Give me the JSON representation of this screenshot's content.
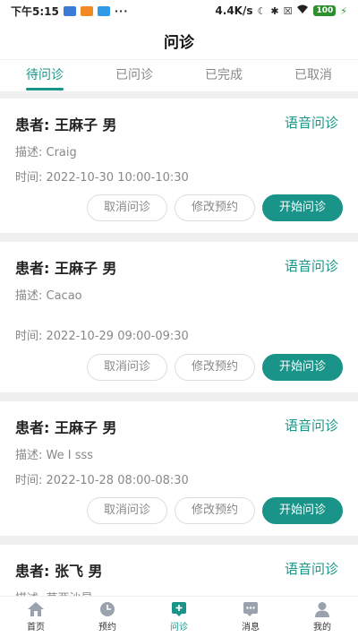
{
  "status_bar": {
    "time": "下午5:15",
    "dots": "···",
    "net_speed": "4.4K/s",
    "battery": "100"
  },
  "header": {
    "title": "问诊"
  },
  "tabs": [
    {
      "label": "待问诊",
      "active": true
    },
    {
      "label": "已问诊",
      "active": false
    },
    {
      "label": "已完成",
      "active": false
    },
    {
      "label": "已取消",
      "active": false
    }
  ],
  "consultations": [
    {
      "patient": "患者: 王麻子 男",
      "type": "语音问诊",
      "desc": "描述: Craig",
      "time": "时间: 2022-10-30 10:00-10:30"
    },
    {
      "patient": "患者: 王麻子 男",
      "type": "语音问诊",
      "desc": "描述: Cacao",
      "time": "时间: 2022-10-29 09:00-09:30"
    },
    {
      "patient": "患者: 王麻子 男",
      "type": "语音问诊",
      "desc": "描述: We I sss",
      "time": "时间: 2022-10-28 08:00-08:30"
    },
    {
      "patient": "患者: 张飞 男",
      "type": "语音问诊",
      "desc": "描述: 草两沙是",
      "time": ""
    }
  ],
  "actions": {
    "cancel": "取消问诊",
    "modify": "修改预约",
    "start": "开始问诊"
  },
  "bottom_nav": [
    {
      "label": "首页",
      "icon": "home-icon"
    },
    {
      "label": "预约",
      "icon": "clock-icon"
    },
    {
      "label": "问诊",
      "icon": "consult-plus-icon",
      "active": true
    },
    {
      "label": "消息",
      "icon": "message-icon"
    },
    {
      "label": "我的",
      "icon": "profile-icon"
    }
  ],
  "colors": {
    "accent": "#1a9488",
    "background": "#efefef"
  }
}
